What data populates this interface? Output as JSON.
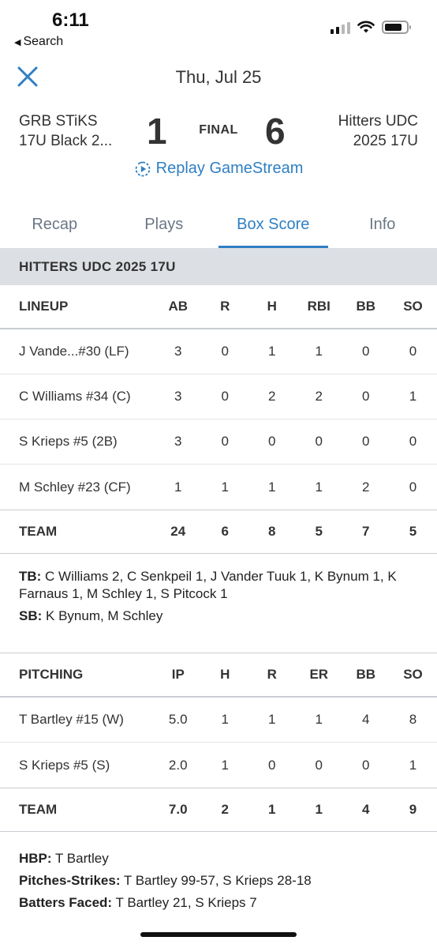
{
  "status_bar": {
    "time": "6:11",
    "back_label": "Search"
  },
  "header": {
    "date": "Thu, Jul 25"
  },
  "scoreboard": {
    "away_team_line1": "GRB STiKS",
    "away_team_line2": "17U Black 2...",
    "away_score": "1",
    "status": "FINAL",
    "home_score": "6",
    "home_team_line1": "Hitters UDC",
    "home_team_line2": "2025 17U",
    "replay_label": "Replay GameStream"
  },
  "tabs": [
    {
      "label": "Recap"
    },
    {
      "label": "Plays"
    },
    {
      "label": "Box Score"
    },
    {
      "label": "Info"
    }
  ],
  "active_tab": "Box Score",
  "team_section": "HITTERS UDC 2025 17U",
  "lineup": {
    "columns": [
      "LINEUP",
      "AB",
      "R",
      "H",
      "RBI",
      "BB",
      "SO"
    ],
    "rows": [
      [
        "J Vande...#30 (LF)",
        "3",
        "0",
        "1",
        "1",
        "0",
        "0"
      ],
      [
        "C Williams #34 (C)",
        "3",
        "0",
        "2",
        "2",
        "0",
        "1"
      ],
      [
        "S Krieps #5 (2B)",
        "3",
        "0",
        "0",
        "0",
        "0",
        "0"
      ],
      [
        "M Schley #23 (CF)",
        "1",
        "1",
        "1",
        "1",
        "2",
        "0"
      ]
    ],
    "totals": [
      "TEAM",
      "24",
      "6",
      "8",
      "5",
      "7",
      "5"
    ]
  },
  "batting_notes": {
    "tb_label": "TB:",
    "tb_value": " C Williams 2, C Senkpeil 1, J Vander Tuuk 1, K Bynum 1, K Farnaus 1, M Schley 1, S Pitcock 1",
    "sb_label": "SB:",
    "sb_value": " K Bynum, M Schley"
  },
  "pitching": {
    "columns": [
      "PITCHING",
      "IP",
      "H",
      "R",
      "ER",
      "BB",
      "SO"
    ],
    "rows": [
      [
        "T Bartley #15 (W)",
        "5.0",
        "1",
        "1",
        "1",
        "4",
        "8"
      ],
      [
        "S Krieps #5 (S)",
        "2.0",
        "1",
        "0",
        "0",
        "0",
        "1"
      ]
    ],
    "totals": [
      "TEAM",
      "7.0",
      "2",
      "1",
      "1",
      "4",
      "9"
    ]
  },
  "pitching_notes": {
    "hbp_label": "HBP:",
    "hbp_value": " T Bartley",
    "ps_label": "Pitches-Strikes:",
    "ps_value": " T Bartley 99-57, S Krieps 28-18",
    "bf_label": "Batters Faced:",
    "bf_value": " T Bartley 21, S Krieps 7"
  },
  "colors": {
    "accent": "#2f7fc2",
    "section_bg": "#dcdfe3",
    "text": "#333333"
  }
}
